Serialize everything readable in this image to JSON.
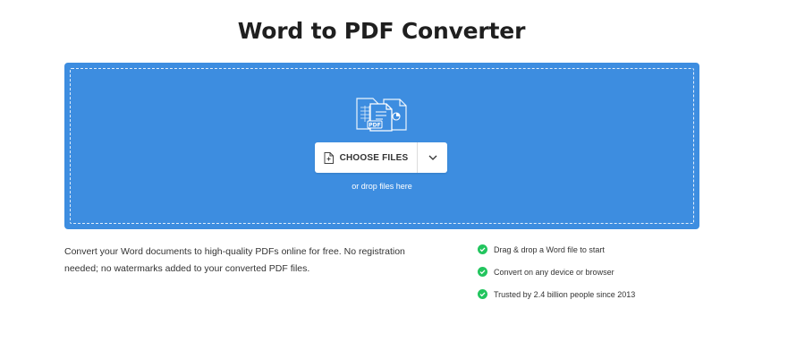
{
  "page": {
    "title": "Word to PDF Converter"
  },
  "dropzone": {
    "illustration_icon": "word-to-pdf-documents-icon",
    "illustration_badge": "PDF",
    "choose_button_label": "CHOOSE FILES",
    "choose_button_icon": "file-plus-icon",
    "dropdown_icon": "chevron-down-icon",
    "hint": "or drop files here",
    "background_color": "#3d8de0"
  },
  "description": "Convert your Word documents to high-quality PDFs online for free. No registration needed; no watermarks added to your converted PDF files.",
  "features": [
    {
      "icon": "check-circle-icon",
      "text": "Drag & drop a Word file to start"
    },
    {
      "icon": "check-circle-icon",
      "text": "Convert on any device or browser"
    },
    {
      "icon": "check-circle-icon",
      "text": "Trusted by 2.4 billion people since 2013"
    }
  ],
  "colors": {
    "check": "#22c55e"
  }
}
